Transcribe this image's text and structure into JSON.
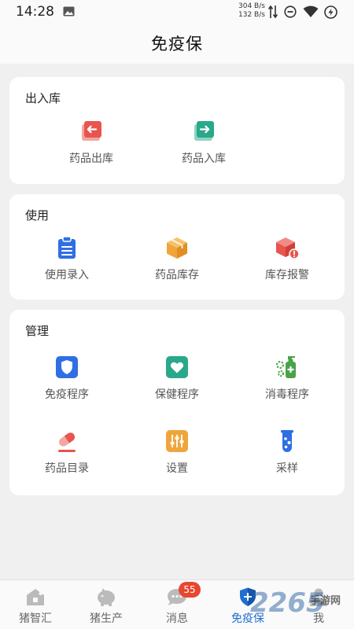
{
  "status_bar": {
    "time": "14:28",
    "net_speed_up": "304 B/s",
    "net_speed_down": "132 B/s"
  },
  "header": {
    "title": "免疫保"
  },
  "sections": [
    {
      "title": "出入库",
      "items": [
        {
          "label": "药品出库",
          "icon": "drug-out-icon",
          "color": "#e8554e"
        },
        {
          "label": "药品入库",
          "icon": "drug-in-icon",
          "color": "#2aa88a"
        }
      ]
    },
    {
      "title": "使用",
      "items": [
        {
          "label": "使用录入",
          "icon": "clipboard-icon",
          "color": "#2f6fe4"
        },
        {
          "label": "药品库存",
          "icon": "box-icon",
          "color": "#f0a53b"
        },
        {
          "label": "库存报警",
          "icon": "box-alert-icon",
          "color": "#e8554e"
        }
      ]
    },
    {
      "title": "管理",
      "items": [
        {
          "label": "免疫程序",
          "icon": "shield-icon",
          "color": "#2f6fe4"
        },
        {
          "label": "保健程序",
          "icon": "heart-icon",
          "color": "#2aa88a"
        },
        {
          "label": "消毒程序",
          "icon": "sanitizer-icon",
          "color": "#4aa24a"
        },
        {
          "label": "药品目录",
          "icon": "pill-icon",
          "color": "#e8554e"
        },
        {
          "label": "设置",
          "icon": "sliders-icon",
          "color": "#f0a53b"
        },
        {
          "label": "采样",
          "icon": "test-tube-icon",
          "color": "#2f6fe4"
        }
      ]
    }
  ],
  "tabs": [
    {
      "label": "猪智汇",
      "icon": "house-icon",
      "active": false
    },
    {
      "label": "猪生产",
      "icon": "piggy-icon",
      "active": false
    },
    {
      "label": "消息",
      "icon": "chat-icon",
      "active": false,
      "badge": "55"
    },
    {
      "label": "免疫保",
      "icon": "shield-plus-icon",
      "active": true
    },
    {
      "label": "我",
      "icon": "person-icon",
      "active": false
    }
  ],
  "watermark": {
    "text": "2265",
    "sub": "手游网"
  },
  "colors": {
    "accent": "#1f6fd1",
    "badge": "#e8472f",
    "background": "#f0f0f0"
  }
}
